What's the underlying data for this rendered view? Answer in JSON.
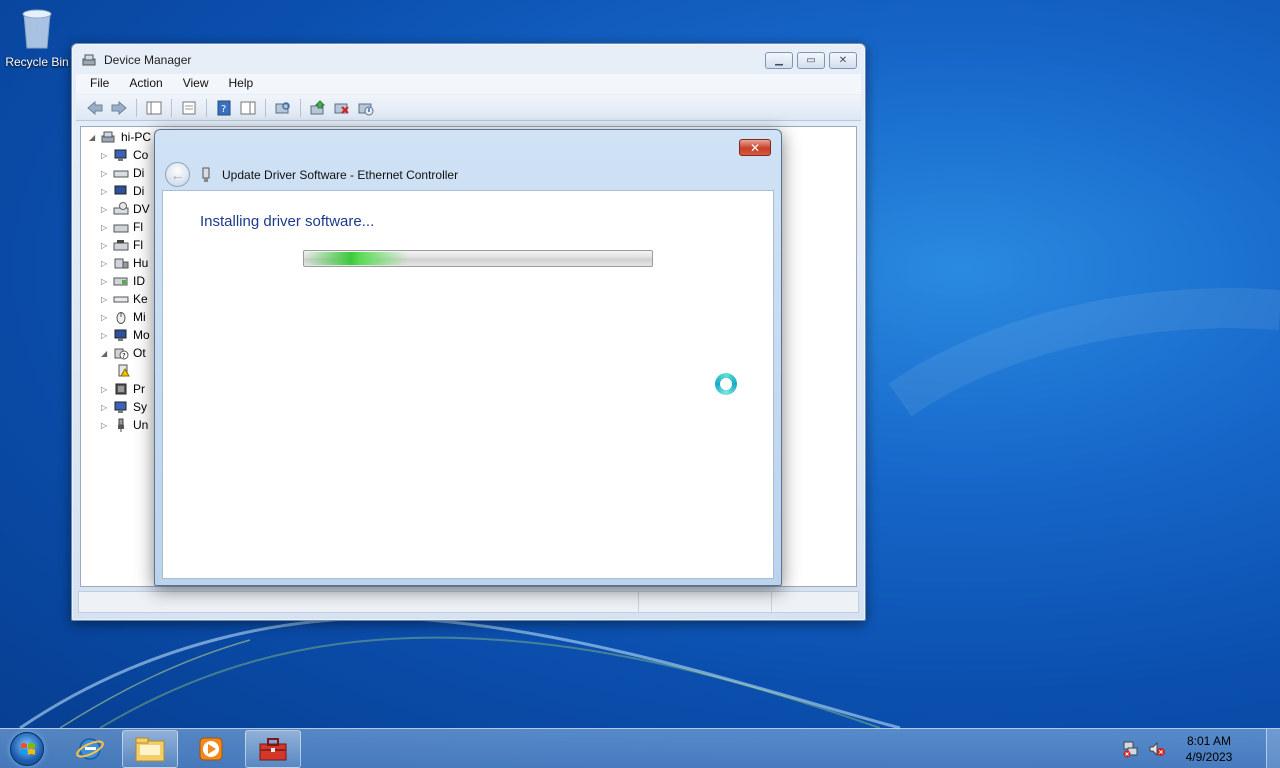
{
  "desktop": {
    "recycle_bin_label": "Recycle Bin"
  },
  "device_manager": {
    "title": "Device Manager",
    "menu": [
      "File",
      "Action",
      "View",
      "Help"
    ],
    "tree": {
      "root": "hi-PC",
      "items": [
        "Co",
        "Di",
        "Di",
        "DV",
        "Fl",
        "Fl",
        "Hu",
        "ID",
        "Ke",
        "Mi",
        "Mo",
        "Ot",
        "Pr",
        "Sy",
        "Un"
      ]
    }
  },
  "wizard": {
    "title": "Update Driver Software - Ethernet Controller",
    "heading": "Installing driver software...",
    "close_glyph": "✕",
    "back_glyph": "←",
    "progress_fraction": 0.3
  },
  "taskbar": {
    "time": "8:01 AM",
    "date": "4/9/2023"
  },
  "icons": {
    "start": "windows-orb-icon",
    "ie": "internet-explorer-icon",
    "explorer": "file-explorer-icon",
    "media": "media-player-icon",
    "toolbox": "toolbox-icon",
    "network": "network-icon",
    "volume": "volume-muted-icon"
  }
}
